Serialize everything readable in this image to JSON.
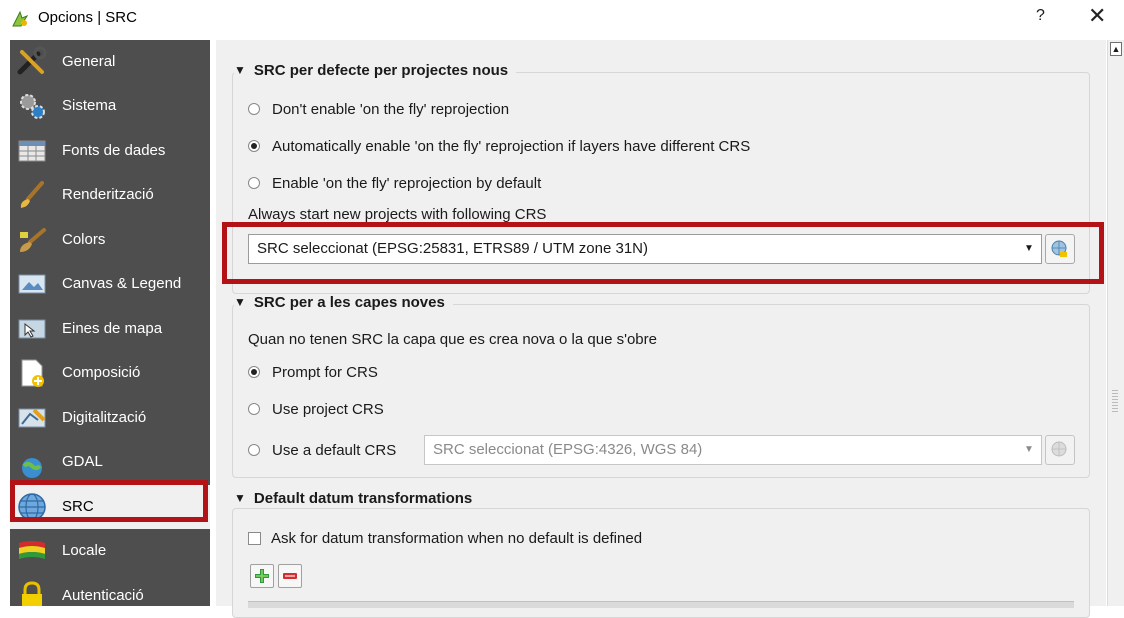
{
  "window": {
    "title": "Opcions | SRC",
    "help_label": "?",
    "close_label": "✕"
  },
  "sidebar": {
    "items": [
      {
        "label": "General",
        "icon": "tools-icon"
      },
      {
        "label": "Sistema",
        "icon": "gears-icon"
      },
      {
        "label": "Fonts de dades",
        "icon": "table-icon"
      },
      {
        "label": "Renderització",
        "icon": "brush-icon"
      },
      {
        "label": "Colors",
        "icon": "paint-icon"
      },
      {
        "label": "Canvas & Legend",
        "icon": "canvas-icon"
      },
      {
        "label": "Eines de mapa",
        "icon": "map-tools-icon"
      },
      {
        "label": "Composició",
        "icon": "composer-icon"
      },
      {
        "label": "Digitalització",
        "icon": "digitizing-icon"
      },
      {
        "label": "GDAL",
        "icon": "gdal-icon"
      },
      {
        "label": "SRC",
        "icon": "globe-icon",
        "selected": true
      },
      {
        "label": "Locale",
        "icon": "flag-icon"
      },
      {
        "label": "Autenticació",
        "icon": "padlock-icon"
      }
    ]
  },
  "sections": {
    "default_crs": {
      "title": "SRC per defecte per projectes nous",
      "radios": [
        {
          "label": "Don't enable 'on the fly' reprojection",
          "checked": false
        },
        {
          "label": "Automatically enable 'on the fly' reprojection if layers have different CRS",
          "checked": true
        },
        {
          "label": "Enable 'on the fly' reprojection by default",
          "checked": false
        }
      ],
      "always_label": "Always start new projects with following CRS",
      "crs_value": "SRC seleccionat (EPSG:25831, ETRS89 / UTM zone 31N)"
    },
    "new_layers": {
      "title": "SRC per a les capes noves",
      "description": "Quan no tenen SRC la capa que es crea nova o la que s'obre",
      "radios": [
        {
          "label": "Prompt for CRS",
          "checked": true
        },
        {
          "label": "Use project CRS",
          "checked": false
        },
        {
          "label": "Use a default CRS",
          "checked": false
        }
      ],
      "default_crs_value": "SRC seleccionat (EPSG:4326, WGS 84)"
    },
    "datum": {
      "title": "Default datum transformations",
      "checkbox_label": "Ask for datum transformation when no default is defined",
      "checkbox_checked": false
    }
  },
  "colors": {
    "highlight": "#b31217",
    "sidebar_bg": "#4e4e4e",
    "panel_bg": "#f0f0f0"
  }
}
